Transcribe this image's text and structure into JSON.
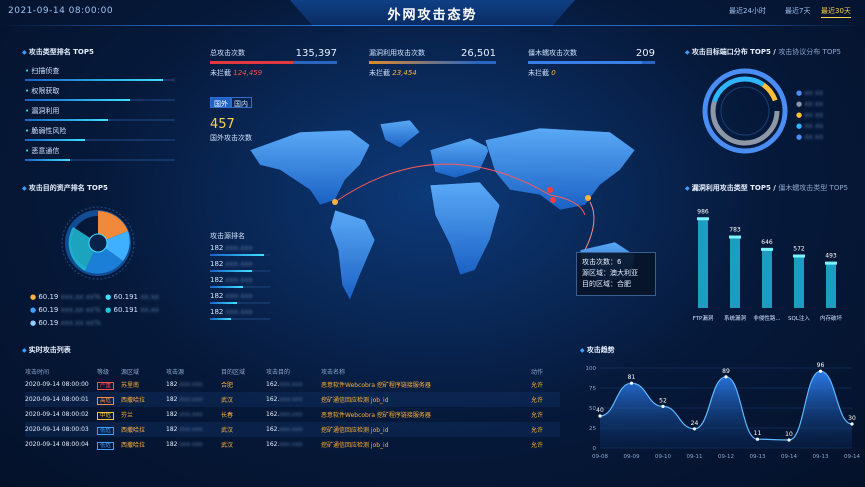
{
  "header": {
    "datetime": "2021-09-14 08:00:00",
    "title": "外网攻击态势",
    "ranges": [
      "最近24小时",
      "最近7天",
      "最近30天"
    ],
    "active_range": "最近30天"
  },
  "attack_types": {
    "title": "攻击类型排名 TOP5",
    "items": [
      {
        "label": "扫描侦查",
        "pct": 0.92
      },
      {
        "label": "权限获取",
        "pct": 0.7
      },
      {
        "label": "漏洞利用",
        "pct": 0.55
      },
      {
        "label": "脆弱性风险",
        "pct": 0.4
      },
      {
        "label": "恶意通信",
        "pct": 0.3
      }
    ]
  },
  "target_assets": {
    "title": "攻击目的资产排名 TOP5",
    "items": [
      "60.19",
      "60.19",
      "60.19",
      "60.191",
      "60.191"
    ]
  },
  "stats": [
    {
      "label": "总攻击次数",
      "value": "135,397",
      "sub_label": "未拦截",
      "sub_value": "124,459",
      "sub_red": true,
      "fill": 0.65
    },
    {
      "label": "漏洞利用攻击次数",
      "value": "26,501",
      "sub_label": "未拦截",
      "sub_value": "23,454",
      "sub_red": false,
      "fill": 0.85
    },
    {
      "label": "僵木蠕攻击次数",
      "value": "209",
      "sub_label": "未拦截",
      "sub_value": "0",
      "sub_red": false,
      "fill": 0.9
    }
  ],
  "map": {
    "tabs": [
      "国外",
      "国内"
    ],
    "active_tab": "国外",
    "count": "457",
    "count_label": "国外攻击次数",
    "source_title": "攻击源排名",
    "sources": [
      {
        "ip": "182",
        "pct": 0.9
      },
      {
        "ip": "182",
        "pct": 0.7
      },
      {
        "ip": "182",
        "pct": 0.55
      },
      {
        "ip": "182",
        "pct": 0.45
      },
      {
        "ip": "182",
        "pct": 0.35
      }
    ],
    "tooltip": [
      "攻击次数：6",
      "源区域：澳大利亚",
      "目的区域：合肥"
    ]
  },
  "ports": {
    "title": "攻击目标端口分布 TOP5 /",
    "sub": "攻击协议分布 TOP5"
  },
  "vuln": {
    "title": "漏洞利用攻击类型 TOP5 /",
    "sub": "僵木蠕攻击类型 TOP5",
    "categories": [
      "FTP漏洞",
      "系统漏洞",
      "非侵性路...",
      "SQL注入",
      "内存破坏"
    ],
    "values": [
      986,
      783,
      646,
      572,
      493
    ]
  },
  "list": {
    "title": "实时攻击列表",
    "headers": [
      "攻击时间",
      "等级",
      "源区域",
      "攻击源",
      "目的区域",
      "攻击目的",
      "攻击名称",
      "动作"
    ],
    "rows": [
      [
        "2020-09-14 08:00:00",
        "严重",
        "苏里南",
        "182",
        "合肥",
        "162.",
        "恶意软件Webcobra 挖矿程序链接服务器",
        "允许"
      ],
      [
        "2020-09-14 08:00:01",
        "高危",
        "西撒哈拉",
        "182",
        "武汉",
        "162.",
        "挖矿通信回应检测 job_id",
        "允许"
      ],
      [
        "2020-09-14 08:00:02",
        "中危",
        "芬兰",
        "182",
        "长春",
        "162.",
        "恶意软件Webcobra 挖矿程序链接服务器",
        "允许"
      ],
      [
        "2020-09-14 08:00:03",
        "低危",
        "西撒哈拉",
        "182",
        "武汉",
        "162.",
        "挖矿通信回应检测 job_id",
        "允许"
      ],
      [
        "2020-09-14 08:00:04",
        "低危",
        "西撒哈拉",
        "182",
        "武汉",
        "162.",
        "挖矿通信回应检测 job_id",
        "允许"
      ]
    ]
  },
  "trend": {
    "title": "攻击趋势"
  },
  "chart_data": {
    "type": "area",
    "categories": [
      "09-08",
      "09-09",
      "09-10",
      "09-11",
      "09-12",
      "09-13",
      "09-14",
      "09-13",
      "09-14"
    ],
    "values": [
      40,
      81,
      52,
      24,
      89,
      11,
      10,
      96,
      30
    ],
    "ylim": [
      0,
      100
    ],
    "yticks": [
      0,
      25,
      50,
      75,
      100
    ],
    "grid": true
  }
}
